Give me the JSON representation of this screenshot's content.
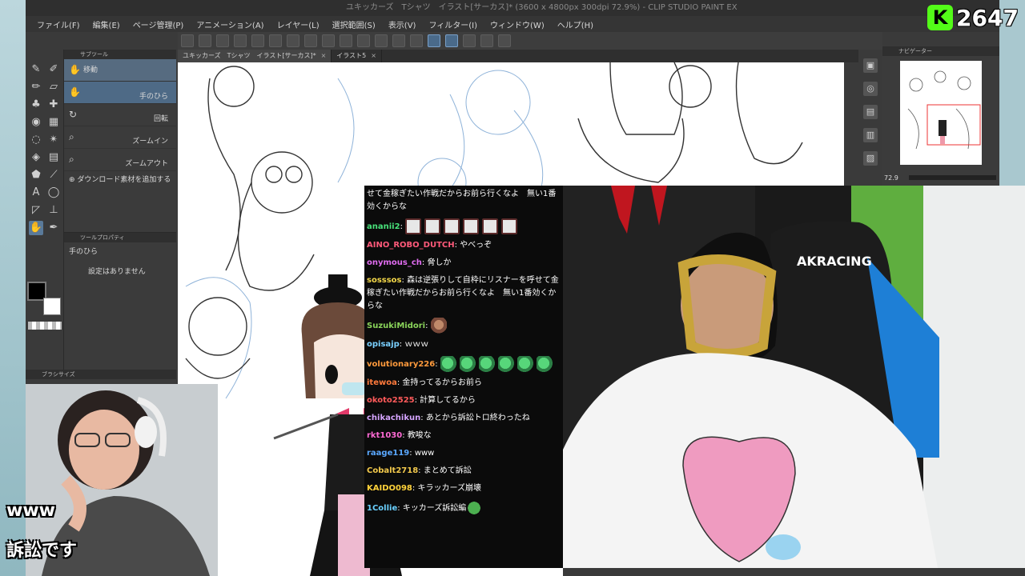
{
  "window": {
    "title": "ユキッカーズ　Tシャツ　イラスト[サーカス]* (3600 x 4800px 300dpi 72.9%) - CLIP STUDIO PAINT EX"
  },
  "menu": [
    "ファイル(F)",
    "編集(E)",
    "ページ管理(P)",
    "アニメーション(A)",
    "レイヤー(L)",
    "選択範囲(S)",
    "表示(V)",
    "フィルター(I)",
    "ウィンドウ(W)",
    "ヘルプ(H)"
  ],
  "tabs": [
    {
      "label": "ユキッカーズ　Tシャツ　イラスト[サーカス]*"
    },
    {
      "label": "イラスト5"
    }
  ],
  "subtool": {
    "header": "サブツール",
    "items": [
      {
        "label": "移動",
        "icon": "hand-icon"
      },
      {
        "label": "手のひら",
        "icon": "hand-icon"
      },
      {
        "label": "回転",
        "icon": "rotate-icon"
      },
      {
        "label": "ズームイン",
        "icon": "zoom-in-icon"
      },
      {
        "label": "ズームアウト",
        "icon": "zoom-out-icon"
      }
    ],
    "add_material": "ダウンロード素材を追加する"
  },
  "tool_property": {
    "header": "ツールプロパティ",
    "name": "手のひら",
    "empty": "設定はありません"
  },
  "brush_size": {
    "header": "ブラシサイズ"
  },
  "navigator": {
    "header": "ナビゲーター",
    "zoom": "72.9"
  },
  "kick_badge": {
    "logo": "K",
    "count": "2647"
  },
  "chat": {
    "messages": [
      {
        "user": "",
        "text": "せて金稼ぎたい作戦だからお前ら行くなよ　無い1番効くからな",
        "color": "#ffffff"
      },
      {
        "user": "ananii2",
        "text": "",
        "emotes": [
          "face",
          "face",
          "face",
          "face",
          "face",
          "face"
        ],
        "color": "#48e27a"
      },
      {
        "user": "AINO_ROBO_DUTCH",
        "text": "やべっぞ",
        "color": "#ff5a7a"
      },
      {
        "user": "onymous_ch",
        "text": "脅しか",
        "color": "#e06cf0"
      },
      {
        "user": "sosssos",
        "text": "森は逆張りして自枠にリスナーを呼せて金稼ぎたい作戦だからお前ら行くなよ　無い1番効くからな",
        "color": "#f4d84a"
      },
      {
        "user": "SuzukiMidori",
        "text": "",
        "emotes": [
          "monk"
        ],
        "color": "#8ad45a"
      },
      {
        "user": "opisajp",
        "text": "ｗｗｗ",
        "color": "#7ad0ff"
      },
      {
        "user": "volutionary226",
        "text": "",
        "emotes": [
          "leaf",
          "leaf",
          "leaf",
          "leaf",
          "leaf",
          "leaf"
        ],
        "color": "#ff9a3c"
      },
      {
        "user": "itewoa",
        "text": "金持ってるからお前ら",
        "color": "#ff7a3c"
      },
      {
        "user": "okoto2525",
        "text": "計算してるから",
        "color": "#ff5a5a"
      },
      {
        "user": "chikachikun",
        "text": "あとから訴訟トロ終わったね",
        "color": "#d6a5ff"
      },
      {
        "user": "rkt1030",
        "text": "教唆な",
        "color": "#ff6ad5"
      },
      {
        "user": "raage119",
        "text": "www",
        "color": "#5aa8ff"
      },
      {
        "user": "Cobalt2718",
        "text": "まとめて訴訟",
        "color": "#f2c94c"
      },
      {
        "user": "KAIDO098",
        "text": "キラッカーズ崩壊",
        "color": "#ffd23a"
      },
      {
        "user": "1Collie",
        "text": "キッカーズ訴訟編",
        "emotes": [
          "frog"
        ],
        "color": "#6ad0ff"
      }
    ]
  },
  "captions": {
    "line1": "www",
    "line2": "訴訟です"
  },
  "webcam": {
    "chair_brand": "AKRACING"
  }
}
